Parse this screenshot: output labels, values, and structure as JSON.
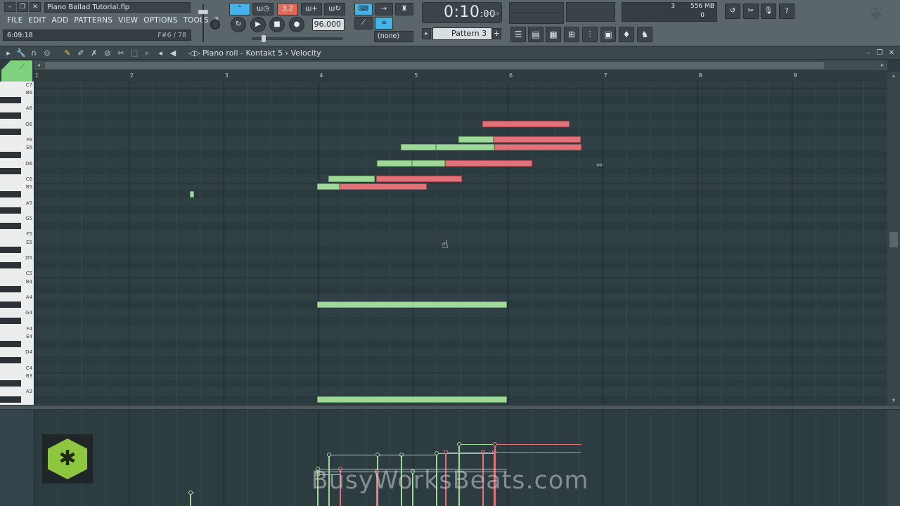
{
  "window": {
    "project_title": "Piano Ballad Tutorial.flp",
    "menu": [
      "FILE",
      "EDIT",
      "ADD",
      "PATTERNS",
      "VIEW",
      "OPTIONS",
      "TOOLS",
      "?"
    ],
    "hint_time": "6:09:18",
    "hint_note": "F#6 / 78"
  },
  "transport": {
    "mode_label": "3.2",
    "tempo": "96.000",
    "time_main": "0:10",
    "time_sub": "00",
    "time_tag": "M:S:CS",
    "snap": "(none)",
    "pattern": "Pattern 3",
    "pattern_add": "+"
  },
  "monitor": {
    "cpu_cores": "3",
    "memory": "556 MB",
    "polyphony": "0"
  },
  "piano_roll": {
    "title": "Piano roll - Kontakt 5",
    "separator": "›",
    "target": "Velocity",
    "bars": [
      "1",
      "2",
      "3",
      "4",
      "5",
      "6",
      "7",
      "8",
      "9"
    ],
    "keys": [
      "C7",
      "B6",
      "A6",
      "G6",
      "F6",
      "E6",
      "D6",
      "C6",
      "B5",
      "A5",
      "G5",
      "F5",
      "E5",
      "D5",
      "C5",
      "B4",
      "A4",
      "G4",
      "F4",
      "E4",
      "D4",
      "C4",
      "B3",
      "A3"
    ]
  },
  "watermark": "BusyWorksBeats.com",
  "colors": {
    "accent": "#45b3e8",
    "note_green": "#9fd89a",
    "note_red": "#e0727a",
    "logo_green": "#8dc63f"
  },
  "icons": {
    "cursor": "hand-pointer-icon",
    "resize": "horizontal-resize-icon"
  }
}
